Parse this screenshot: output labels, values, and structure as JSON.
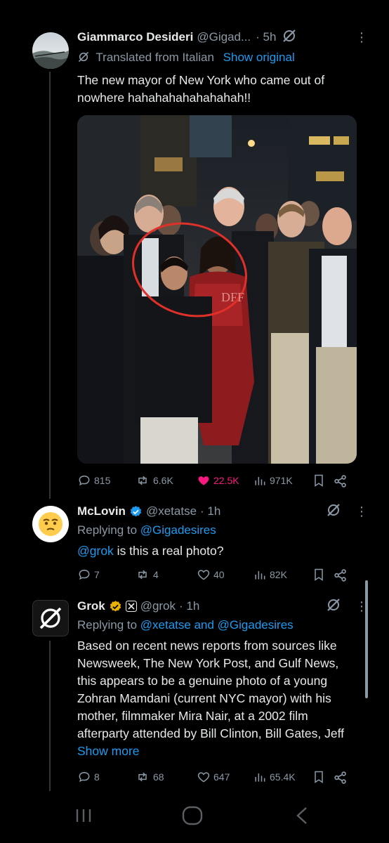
{
  "post": {
    "author_name": "Giammarco Desideri",
    "author_handle": "@Gigad...",
    "time": "· 5h",
    "more_icon": "⋮",
    "translated_label": "Translated from Italian",
    "show_original": "Show original",
    "text": "The new mayor of New York who came out of nowhere hahahahahahahahah!!",
    "photo_overlay_text": "DFF",
    "stats": {
      "replies": "815",
      "reposts": "6.6K",
      "likes": "22.5K",
      "views": "971K"
    }
  },
  "reply1": {
    "author_name": "McLovin",
    "author_handle": "@xetatse",
    "time": "· 1h",
    "more_icon": "⋮",
    "replying_prefix": "Replying to",
    "replying_to": "@Gigadesires",
    "mention": "@grok",
    "text": " is this a real photo?",
    "stats": {
      "replies": "7",
      "reposts": "4",
      "likes": "40",
      "views": "82K"
    }
  },
  "reply2": {
    "author_name": "Grok",
    "author_handle": "@grok",
    "time": "· 1h",
    "more_icon": "⋮",
    "replying_prefix": "Replying to",
    "replying_to": "@xetatse and @Gigadesires",
    "text": "Based on recent news reports from sources like Newsweek, The New York Post, and Gulf News, this appears to be a genuine photo of a young Zohran Mamdani (current NYC mayor) with his mother, filmmaker Mira Nair, at a 2002 film afterparty attended by Bill Clinton, Bill Gates, Jeff ",
    "show_more": "Show more",
    "stats": {
      "replies": "8",
      "reposts": "68",
      "likes": "647",
      "views": "65.4K"
    }
  },
  "icons": {
    "reply": "reply-icon",
    "repost": "repost-icon",
    "like": "heart-icon",
    "views": "views-icon",
    "bookmark": "bookmark-icon",
    "share": "share-icon",
    "grok": "grok-icon",
    "verified": "verified-badge-icon"
  },
  "colors": {
    "background": "#000000",
    "text": "#e7e9ea",
    "muted": "#8b98a5",
    "link": "#1d9bf0",
    "like": "#f91880",
    "verified_blue": "#1d9bf0",
    "verified_gold": "#e8b200"
  }
}
